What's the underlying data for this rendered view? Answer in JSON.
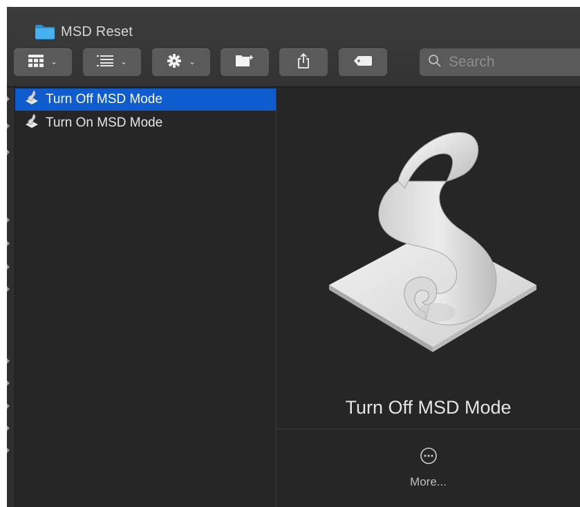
{
  "window": {
    "title": "MSD Reset",
    "title_icon": "folder-icon"
  },
  "toolbar": {
    "view_icon": "grid-view-icon",
    "group_icon": "list-group-icon",
    "action_icon": "gear-icon",
    "chevron": "⌄",
    "new_folder_icon": "new-folder-icon",
    "share_icon": "share-icon",
    "tags_icon": "tag-icon",
    "search_placeholder": "Search"
  },
  "files": [
    {
      "name": "Turn Off MSD Mode",
      "icon": "script-icon",
      "selected": true
    },
    {
      "name": "Turn On MSD Mode",
      "icon": "script-icon",
      "selected": false
    }
  ],
  "preview": {
    "title": "Turn Off MSD Mode",
    "more_label": "More...",
    "icon": "applescript-scroll-icon"
  },
  "colors": {
    "selection": "#0f5ccf",
    "background": "#262626",
    "toolbar_button": "#5a5a5a",
    "folder": "#3fa9e8"
  }
}
